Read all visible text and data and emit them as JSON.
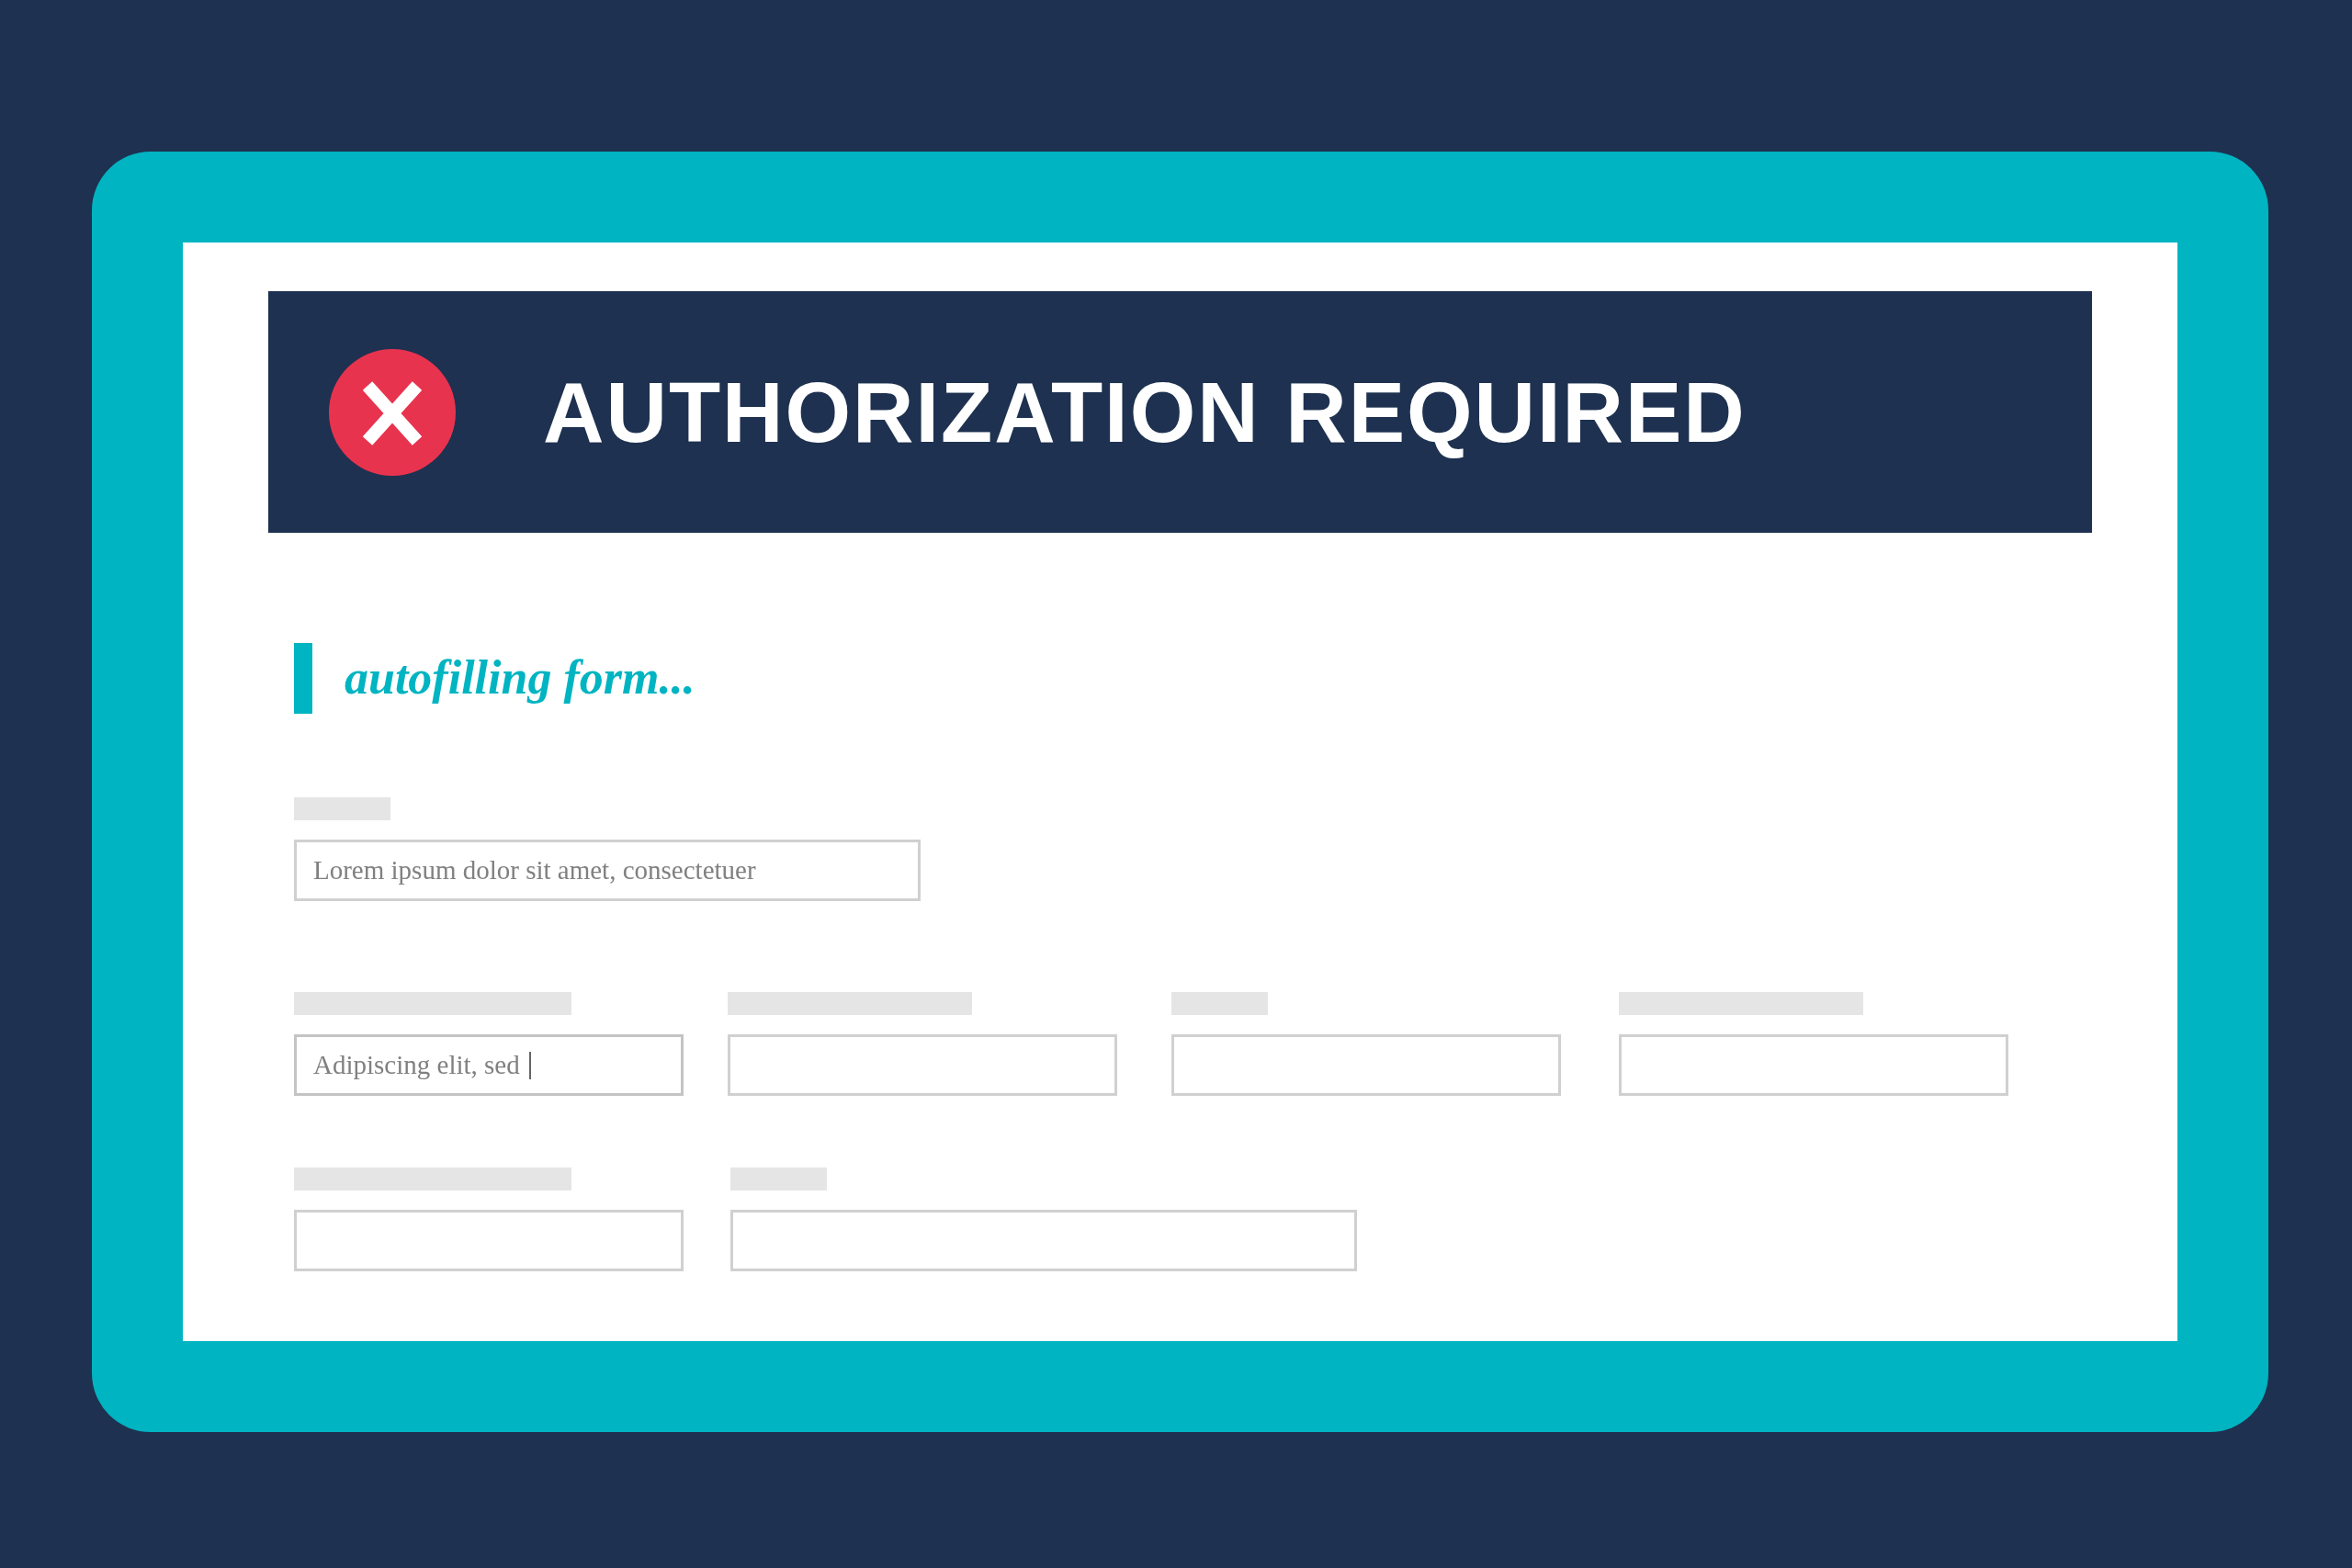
{
  "header": {
    "title": "AUTHORIZATION REQUIRED"
  },
  "status": {
    "text": "autofilling form..."
  },
  "form": {
    "rows": [
      [
        {
          "value": "Lorem ipsum dolor sit amet, consectetuer",
          "focused": false
        }
      ],
      [
        {
          "value": "Adipiscing elit, sed",
          "focused": true
        },
        {
          "focused": false
        },
        {
          "focused": false
        },
        {
          "focused": false
        }
      ],
      [
        {
          "focused": false
        },
        {
          "focused": false
        }
      ]
    ]
  }
}
